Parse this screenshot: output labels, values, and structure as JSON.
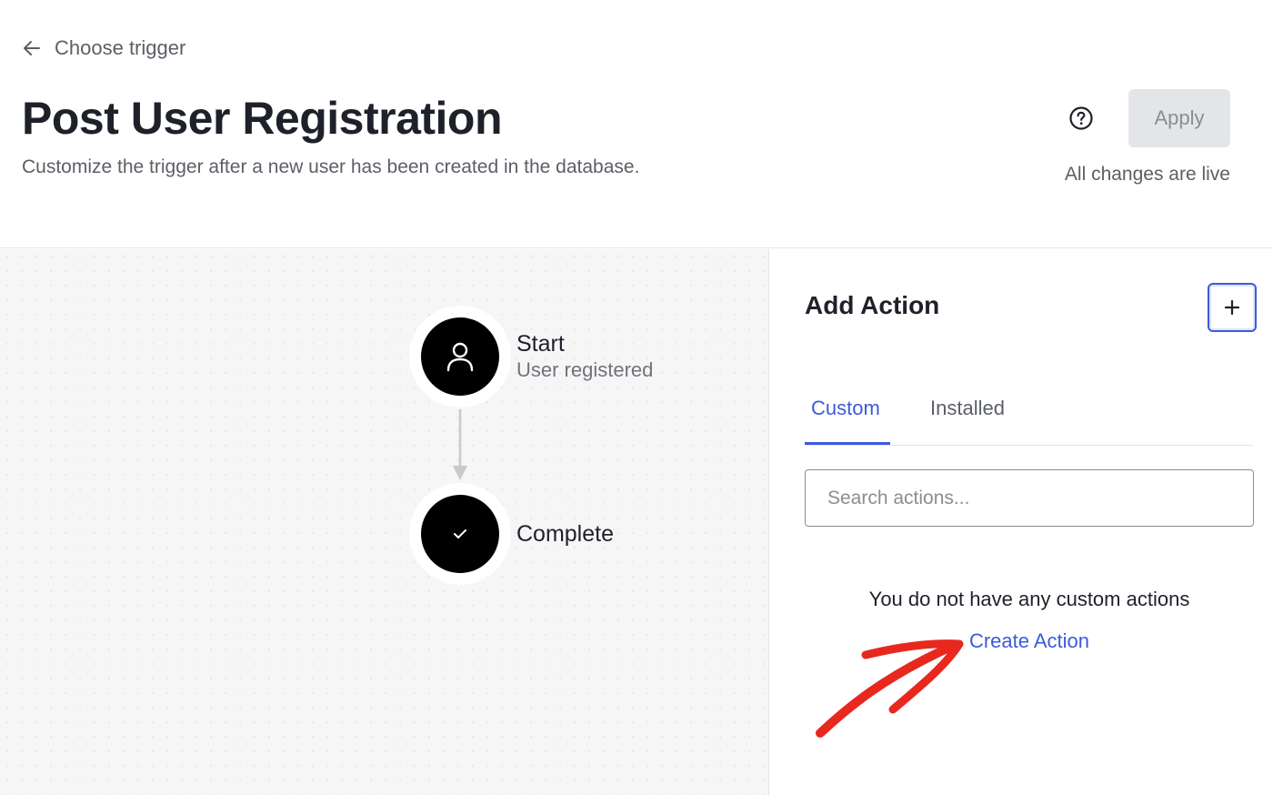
{
  "header": {
    "back_label": "Choose trigger",
    "title": "Post User Registration",
    "subtitle": "Customize the trigger after a new user has been created in the database.",
    "apply_label": "Apply",
    "live_status": "All changes are live",
    "help_icon": "help-circle-icon"
  },
  "flow": {
    "start": {
      "title": "Start",
      "subtitle": "User registered",
      "icon": "user-icon"
    },
    "complete": {
      "title": "Complete",
      "icon": "check-icon"
    }
  },
  "panel": {
    "title": "Add Action",
    "add_icon": "plus-icon",
    "tabs": [
      {
        "label": "Custom",
        "active": true
      },
      {
        "label": "Installed",
        "active": false
      }
    ],
    "search_placeholder": "Search actions...",
    "empty_message": "You do not have any custom actions",
    "create_link": "Create Action"
  },
  "colors": {
    "accent": "#3b5bdb",
    "annotation": "#e8281e",
    "node": "#000000",
    "canvas": "#f6f6f7"
  }
}
